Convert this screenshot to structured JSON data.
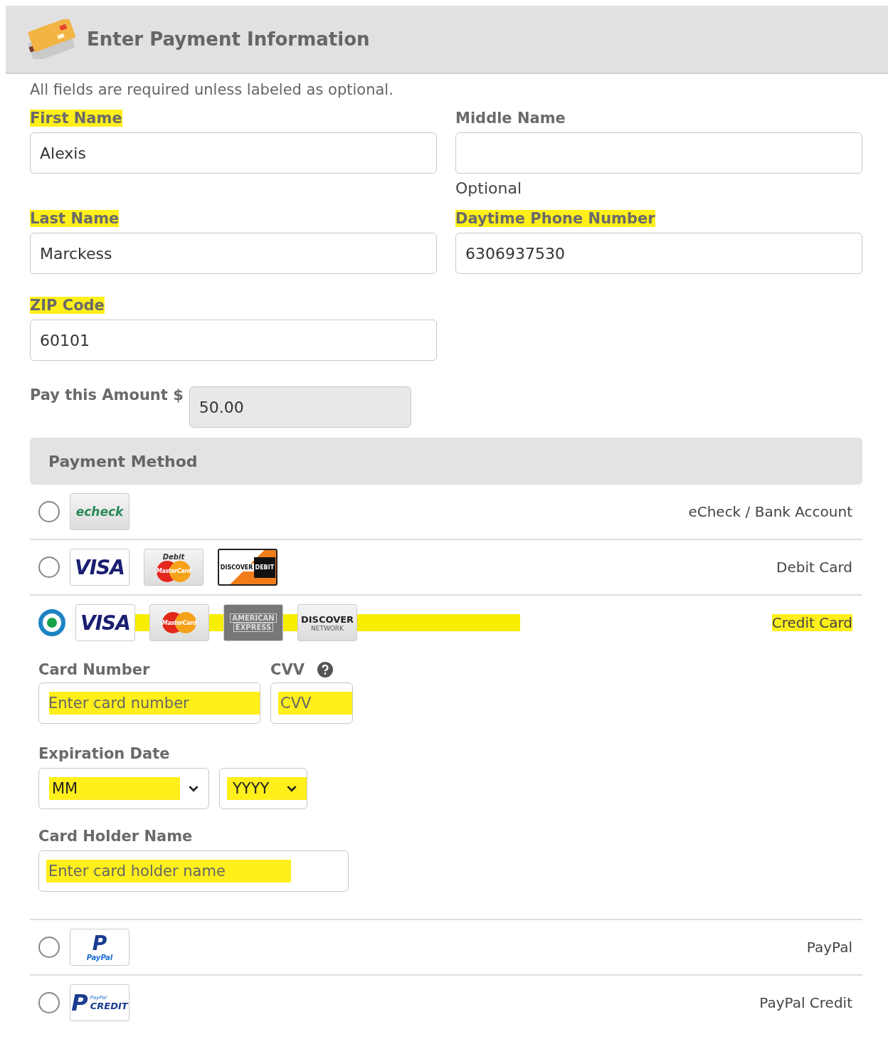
{
  "header": {
    "title": "Enter Payment Information"
  },
  "note": "All fields are required unless labeled as optional.",
  "fields": [
    {
      "label": "First Name",
      "value": "Alexis",
      "highlighted": true
    },
    {
      "label": "Middle Name",
      "hint": "Optional",
      "highlighted": false
    },
    {
      "label": "Last Name",
      "value": "Marckess",
      "highlighted": true
    },
    {
      "label": "Daytime Phone Number",
      "value": "6306937530",
      "highlighted": true
    },
    {
      "label": "ZIP Code",
      "value": "60101",
      "highlighted": true
    }
  ],
  "amount": {
    "label": "Pay this Amount $",
    "value": "50.00"
  },
  "payment_method": {
    "title": "Payment Method",
    "options": [
      {
        "label": "eCheck / Bank Account",
        "selected": false,
        "highlighted": false,
        "logos_highlighted": false,
        "logos": [
          {
            "kind": "echeck",
            "texts": [
              "echeck"
            ]
          }
        ]
      },
      {
        "label": "Debit Card",
        "selected": false,
        "highlighted": false,
        "logos_highlighted": false,
        "logos": [
          {
            "kind": "visa",
            "texts": [
              "VISA"
            ]
          },
          {
            "kind": "mastercard",
            "texts": [
              "Debit",
              "MasterCard"
            ]
          },
          {
            "kind": "discover-debit",
            "texts": [
              "DISCOVER",
              "DEBIT"
            ]
          }
        ]
      },
      {
        "label": "Credit Card",
        "selected": true,
        "highlighted": true,
        "logos_highlighted": true,
        "logos": [
          {
            "kind": "visa",
            "texts": [
              "VISA"
            ]
          },
          {
            "kind": "mastercard",
            "texts": [
              "MasterCard"
            ]
          },
          {
            "kind": "amex",
            "texts": [
              "AMERICAN",
              "EXPRESS"
            ]
          },
          {
            "kind": "discover",
            "texts": [
              "DISCOVER",
              "NETWORK"
            ]
          }
        ],
        "details": {
          "card_number": {
            "label": "Card Number",
            "placeholder": "Enter card number",
            "highlighted": true
          },
          "cvv": {
            "label": "CVV",
            "placeholder": "CVV",
            "highlighted": true
          },
          "expiration": {
            "label": "Expiration Date",
            "month": {
              "value": "MM",
              "highlighted": true
            },
            "year": {
              "value": "YYYY",
              "highlighted": true
            }
          },
          "holder": {
            "label": "Card Holder Name",
            "placeholder": "Enter card holder name",
            "highlighted": true
          }
        }
      },
      {
        "label": "PayPal",
        "selected": false,
        "highlighted": false,
        "logos_highlighted": false,
        "logos": [
          {
            "kind": "paypal",
            "texts": [
              "P",
              "PayPal"
            ]
          }
        ]
      },
      {
        "label": "PayPal Credit",
        "selected": false,
        "highlighted": false,
        "logos_highlighted": false,
        "logos": [
          {
            "kind": "paypal-credit",
            "texts": [
              "P",
              "PayPal",
              "CREDIT"
            ]
          }
        ]
      }
    ]
  }
}
